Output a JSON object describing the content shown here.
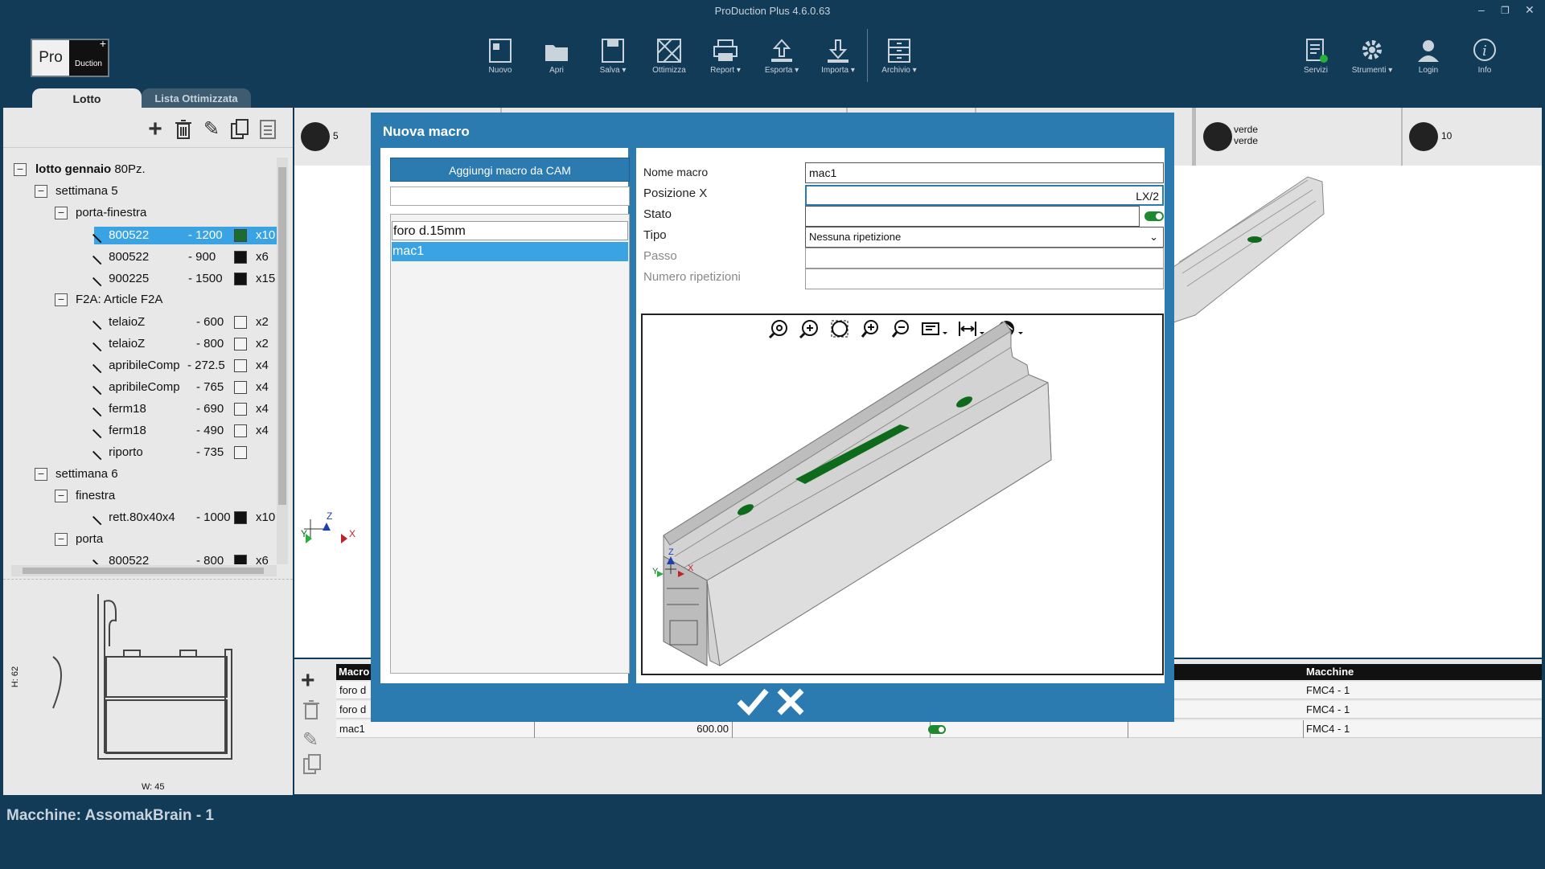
{
  "window": {
    "title": "ProDuction Plus 4.6.0.63"
  },
  "logo": {
    "left": "Pro",
    "right": "Duction"
  },
  "toolbar": {
    "nuovo": "Nuovo",
    "apri": "Apri",
    "salva": "Salva",
    "ottimizza": "Ottimizza",
    "report": "Report",
    "esporta": "Esporta",
    "importa": "Importa",
    "archivio": "Archivio",
    "servizi": "Servizi",
    "strumenti": "Strumenti",
    "login": "Login",
    "info": "Info"
  },
  "tabs": {
    "lotto": "Lotto",
    "lista": "Lista Ottimizzata"
  },
  "tree": {
    "root": {
      "name": "lotto gennaio",
      "count": "80Pz."
    },
    "settimana5": "settimana 5",
    "porta_finestra": "porta-finestra",
    "items_pf": [
      {
        "code": "800522",
        "len": "- 1200",
        "qty": "x10",
        "color": "#1e6b2e"
      },
      {
        "code": "800522",
        "len": "- 900",
        "qty": "x6",
        "color": "#111111"
      },
      {
        "code": "900225",
        "len": "- 1500",
        "qty": "x15",
        "color": "#111111"
      }
    ],
    "f2a": "F2A: Article F2A",
    "items_f2a": [
      {
        "code": "telaioZ",
        "len": "- 600",
        "qty": "x2"
      },
      {
        "code": "telaioZ",
        "len": "- 800",
        "qty": "x2"
      },
      {
        "code": "apribileComp",
        "len": "- 272.5",
        "qty": "x4"
      },
      {
        "code": "apribileComp",
        "len": "- 765",
        "qty": "x4"
      },
      {
        "code": "ferm18",
        "len": "- 690",
        "qty": "x4"
      },
      {
        "code": "ferm18",
        "len": "- 490",
        "qty": "x4"
      },
      {
        "code": "riporto",
        "len": "- 735",
        "qty": ""
      }
    ],
    "settimana6": "settimana 6",
    "finestra": "finestra",
    "item_fin": {
      "code": "rett.80x40x4",
      "len": "- 1000",
      "qty": "x10"
    },
    "porta": "porta",
    "item_porta": {
      "code": "800522",
      "len": "- 800",
      "qty": "x6"
    }
  },
  "profile": {
    "height": "H: 62",
    "width": "W: 45"
  },
  "infobar": {
    "count_left": "5",
    "verde1": "verde",
    "verde2": "verde",
    "count_right": "10"
  },
  "table": {
    "headers": {
      "macro": "Macro",
      "macchine": "Macchine"
    },
    "rows": [
      {
        "macro": "foro d",
        "pos": "",
        "machine": "FMC4 - 1"
      },
      {
        "macro": "foro d",
        "pos": "",
        "machine": "FMC4 - 1"
      },
      {
        "macro": "mac1",
        "pos": "600.00",
        "machine": "FMC4 - 1"
      }
    ]
  },
  "status": {
    "text": "Macchine:  AssomakBrain - 1"
  },
  "modal": {
    "title": "Nuova macro",
    "cam_button": "Aggiungi macro da CAM",
    "search_value": "",
    "list": [
      "foro d.15mm",
      "mac1"
    ],
    "selected_index": 1,
    "fields": {
      "nome_label": "Nome macro",
      "nome_value": "mac1",
      "posx_label": "Posizione X",
      "posx_value": "LX/2",
      "stato_label": "Stato",
      "stato_value": "",
      "tipo_label": "Tipo",
      "tipo_value": "Nessuna ripetizione",
      "passo_label": "Passo",
      "passo_value": "",
      "nrip_label": "Numero ripetizioni",
      "nrip_value": ""
    },
    "accent": "#2b7ab0",
    "selection": "#3aa3e3",
    "feature_color": "#0f6b1c"
  }
}
